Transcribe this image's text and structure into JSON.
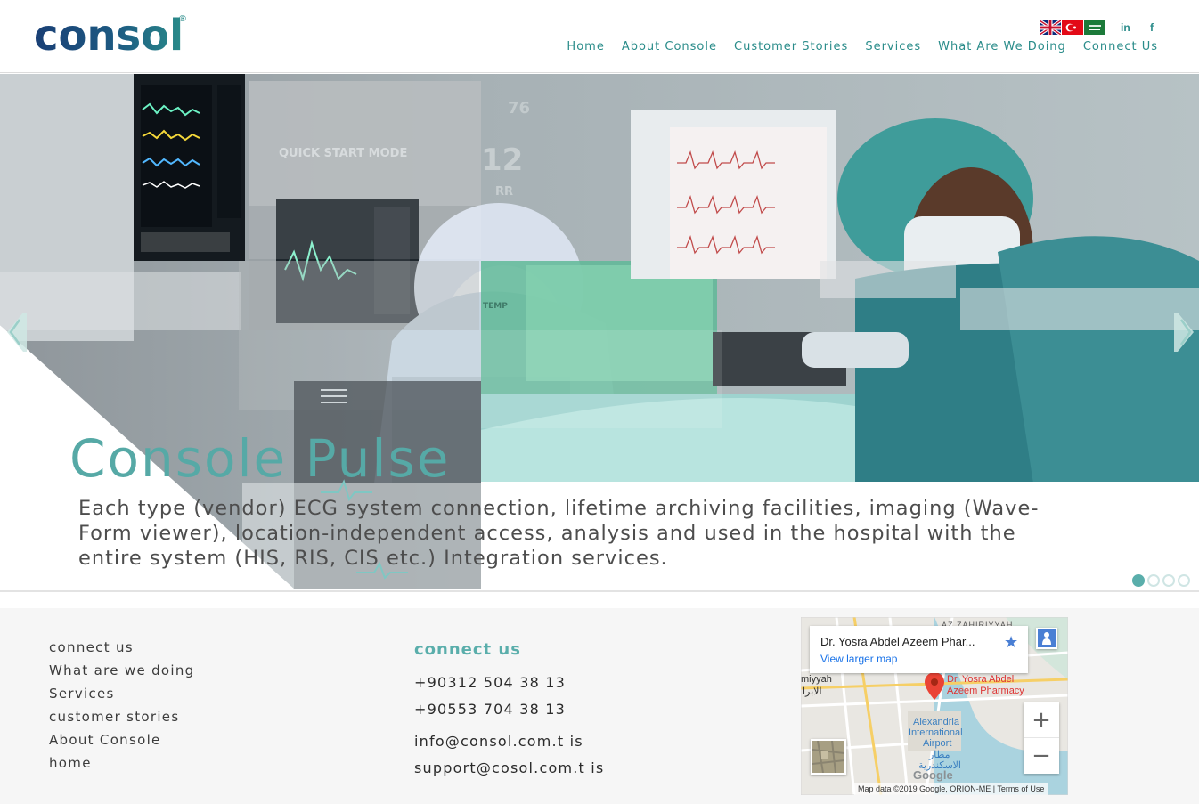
{
  "brand": {
    "logo_text": "consol",
    "registered": "®"
  },
  "header": {
    "flags": [
      "English",
      "Turkish",
      "Arabic"
    ],
    "social": [
      "in",
      "f"
    ],
    "nav": [
      "Home",
      "About Console",
      "Customer Stories",
      "Services",
      "What Are We Doing",
      "Connect Us"
    ]
  },
  "hero": {
    "title": "Console Pulse",
    "description": "Each type (vendor) ECG system connection, lifetime archiving facilities, imaging (Wave-Form viewer), location-independent access, analysis and used in the hospital with the entire system (HIS, RIS, CIS etc.) Integration services.",
    "image_texts": [
      "QUICK START MODE",
      "12",
      "RR",
      "76",
      "TEMP"
    ],
    "slide_count": 4,
    "active_slide": 1
  },
  "footer": {
    "links": [
      "connect us",
      "What are we doing",
      "Services",
      "customer stories",
      "About Console",
      "home"
    ],
    "contact": {
      "title": "connect us",
      "phones": [
        "+90312 504 38 13",
        "+90553 704 38 13"
      ],
      "emails": [
        "info@consol.com.t is",
        "support@cosol.com.t is"
      ]
    }
  },
  "map": {
    "place_title": "Dr. Yosra Abdel Azeem Phar...",
    "larger_map": "View larger map",
    "pin_label_1": "Dr. Yosra Abdel",
    "pin_label_2": "Azeem Pharmacy",
    "district": "AZ ZAHIRIYYAH",
    "area_1": "miyyah",
    "area_2": "الابرا",
    "airport_1": "Alexandria",
    "airport_2": "International",
    "airport_3": "Airport",
    "airport_ar_1": "مطار",
    "airport_ar_2": "الاسكندرية",
    "google": "Google",
    "attribution": "Map data ©2019 Google, ORION-ME",
    "terms": "Terms of Use",
    "zoom_in": "+",
    "zoom_out": "−"
  },
  "colors": {
    "accent": "#2a8c8a",
    "title": "#56a9a6",
    "logo_navy": "#1a3a6b"
  }
}
